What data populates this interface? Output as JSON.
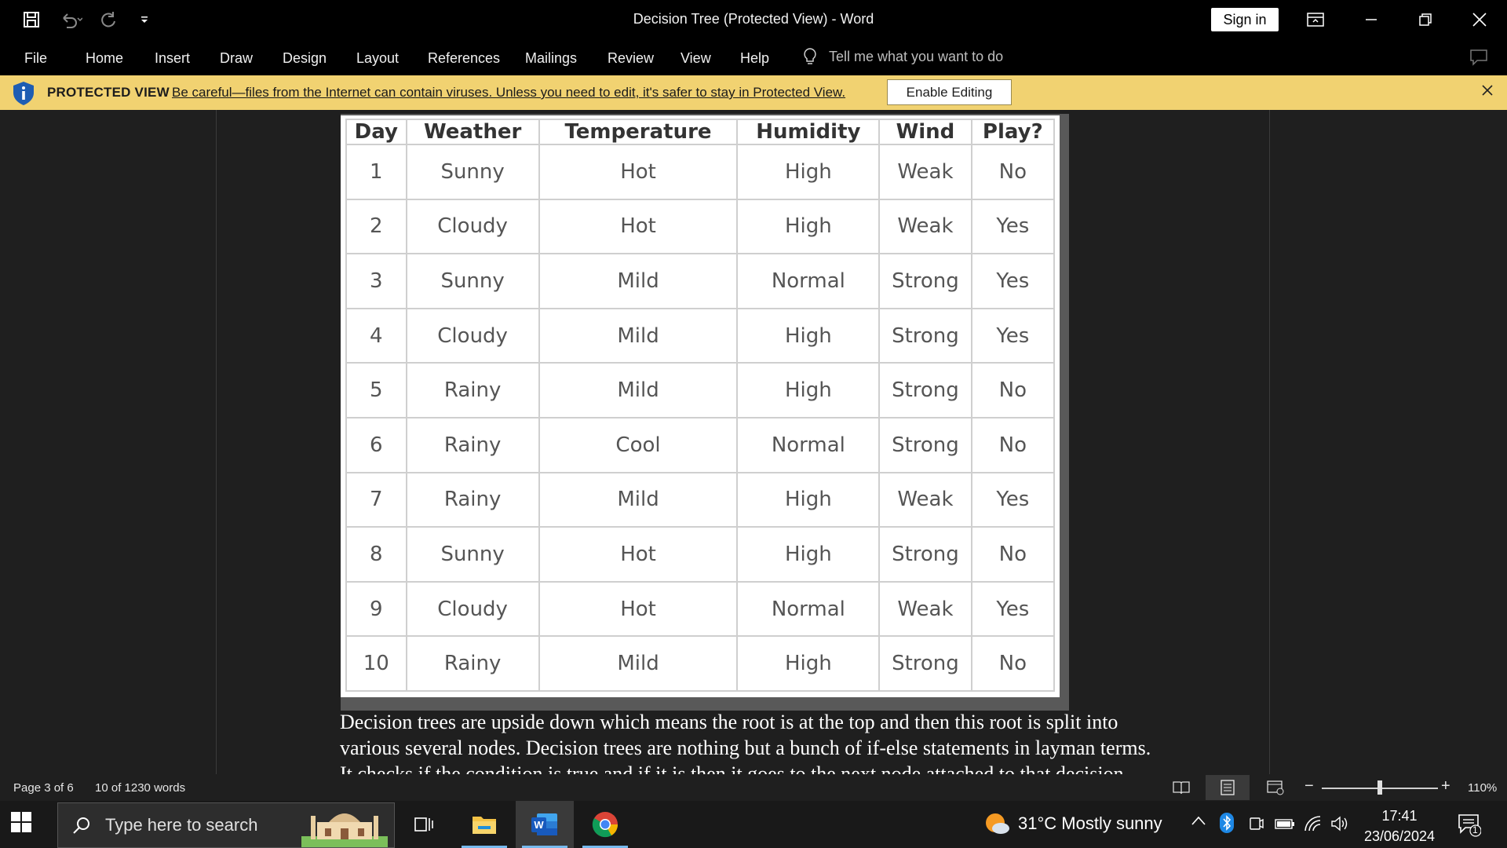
{
  "window": {
    "title": "Decision Tree (Protected View)  -  Word",
    "sign_in": "Sign in"
  },
  "ribbon": {
    "tabs": [
      "File",
      "Home",
      "Insert",
      "Draw",
      "Design",
      "Layout",
      "References",
      "Mailings",
      "Review",
      "View",
      "Help"
    ],
    "tell_me": "Tell me what you want to do"
  },
  "protected_view": {
    "title": "PROTECTED VIEW",
    "message": "Be careful—files from the Internet can contain viruses. Unless you need to edit, it's safer to stay in Protected View.",
    "enable_button": "Enable Editing"
  },
  "document": {
    "table": {
      "headers": [
        "Day",
        "Weather",
        "Temperature",
        "Humidity",
        "Wind",
        "Play?"
      ],
      "rows": [
        [
          "1",
          "Sunny",
          "Hot",
          "High",
          "Weak",
          "No"
        ],
        [
          "2",
          "Cloudy",
          "Hot",
          "High",
          "Weak",
          "Yes"
        ],
        [
          "3",
          "Sunny",
          "Mild",
          "Normal",
          "Strong",
          "Yes"
        ],
        [
          "4",
          "Cloudy",
          "Mild",
          "High",
          "Strong",
          "Yes"
        ],
        [
          "5",
          "Rainy",
          "Mild",
          "High",
          "Strong",
          "No"
        ],
        [
          "6",
          "Rainy",
          "Cool",
          "Normal",
          "Strong",
          "No"
        ],
        [
          "7",
          "Rainy",
          "Mild",
          "High",
          "Weak",
          "Yes"
        ],
        [
          "8",
          "Sunny",
          "Hot",
          "High",
          "Strong",
          "No"
        ],
        [
          "9",
          "Cloudy",
          "Hot",
          "Normal",
          "Weak",
          "Yes"
        ],
        [
          "10",
          "Rainy",
          "Mild",
          "High",
          "Strong",
          "No"
        ]
      ]
    },
    "paragraph": "Decision trees are upside down which means the root is at the top and then this root is split into various several nodes. Decision trees are nothing but a bunch of if-else statements in layman terms. It checks if the condition is true and if it is then it goes to the next node attached to that decision."
  },
  "status_bar": {
    "page": "Page 3 of 6",
    "words": "10 of 1230 words",
    "zoom": "110%"
  },
  "taskbar": {
    "search_placeholder": "Type here to search",
    "weather": "31°C  Mostly sunny",
    "time": "17:41",
    "date": "23/06/2024",
    "notification_count": "1"
  },
  "colors": {
    "protected_bar": "#f1d271",
    "word_blue": "#185abd",
    "dark_bg": "#1f1f1f"
  }
}
